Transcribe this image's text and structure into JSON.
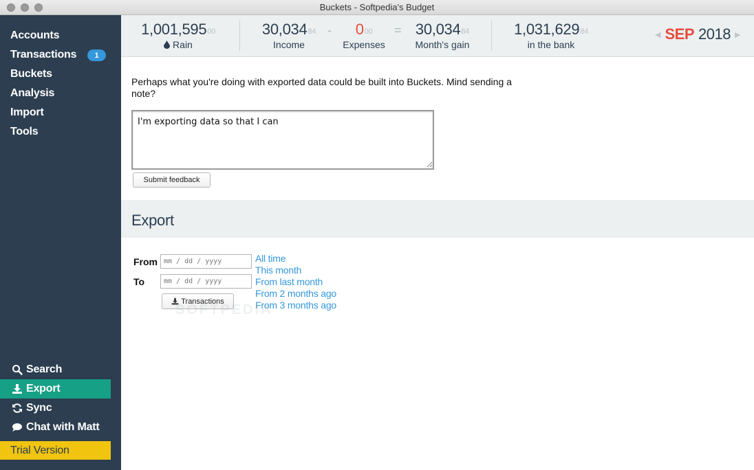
{
  "window": {
    "title": "Buckets - Softpedia's Budget"
  },
  "sidebar": {
    "items": [
      {
        "label": "Accounts"
      },
      {
        "label": "Transactions",
        "badge": "1"
      },
      {
        "label": "Buckets"
      },
      {
        "label": "Analysis"
      },
      {
        "label": "Import"
      },
      {
        "label": "Tools"
      }
    ],
    "bottom": [
      {
        "label": "Search",
        "icon": "search-icon"
      },
      {
        "label": "Export",
        "icon": "download-icon",
        "active": true
      },
      {
        "label": "Sync",
        "icon": "sync-icon"
      },
      {
        "label": "Chat with Matt",
        "icon": "chat-icon"
      }
    ],
    "trial": "Trial Version"
  },
  "header": {
    "rain": {
      "value": "1,001,595",
      "cents": "00",
      "label": "Rain",
      "icon": "drop-icon"
    },
    "income": {
      "value": "30,034",
      "cents": "84",
      "label": "Income"
    },
    "minus": "-",
    "expenses": {
      "value": "0",
      "cents": "00",
      "label": "Expenses"
    },
    "equals": "=",
    "gain": {
      "value": "30,034",
      "cents": "84",
      "label": "Month's gain"
    },
    "bank": {
      "value": "1,031,629",
      "cents": "84",
      "label": "in the bank"
    },
    "month": "SEP",
    "year": "2018",
    "prev_arrow": "◀",
    "next_arrow": "▶"
  },
  "feedback": {
    "message": "Perhaps what you're doing with exported data could be built into Buckets. Mind sending a note?",
    "text_value": "I'm exporting data so that I can",
    "submit_label": "Submit feedback"
  },
  "export": {
    "title": "Export",
    "from_label": "From",
    "to_label": "To",
    "date_placeholder": "mm / dd / yyyy",
    "transactions_button": "Transactions",
    "ranges": [
      "All time",
      "This month",
      "From last month",
      "From 2 months ago",
      "From 3 months ago"
    ]
  },
  "watermark": "SOFTPEDIA",
  "colors": {
    "sidebar_bg": "#2c3e50",
    "active": "#16a085",
    "trial": "#f1c40f",
    "accent": "#3498db",
    "expense": "#e74c3c"
  }
}
